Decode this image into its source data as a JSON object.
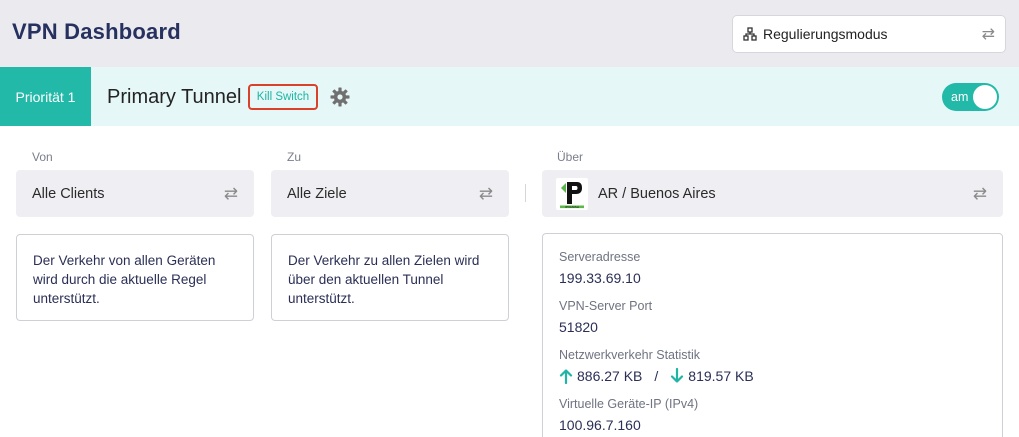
{
  "header": {
    "title": "VPN Dashboard",
    "mode_label": "Regulierungsmodus"
  },
  "tunnel": {
    "priority_label": "Priorität 1",
    "name": "Primary Tunnel",
    "kill_switch_label": "Kill Switch",
    "toggle_label": "am"
  },
  "from": {
    "label": "Von",
    "value": "Alle Clients",
    "description": "Der Verkehr von allen Geräten wird durch die aktuelle Regel unterstützt."
  },
  "to": {
    "label": "Zu",
    "value": "Alle Ziele",
    "description": "Der Verkehr zu allen Zielen wird über den aktuellen Tunnel unterstützt."
  },
  "via": {
    "label": "Über",
    "value": "AR / Buenos Aires",
    "logo_text": "IPVANISH"
  },
  "server": {
    "address_label": "Serveradresse",
    "address": "199.33.69.10",
    "port_label": "VPN-Server Port",
    "port": "51820",
    "traffic_label": "Netzwerkverkehr Statistik",
    "upload": "886.27 KB",
    "separator": "/",
    "download": "819.57 KB",
    "vip_label": "Virtuelle Geräte-IP (IPv4)",
    "vip": "100.96.7.160"
  },
  "colors": {
    "accent": "#23b9a9",
    "highlight_border": "#d9412b",
    "title": "#273160"
  }
}
